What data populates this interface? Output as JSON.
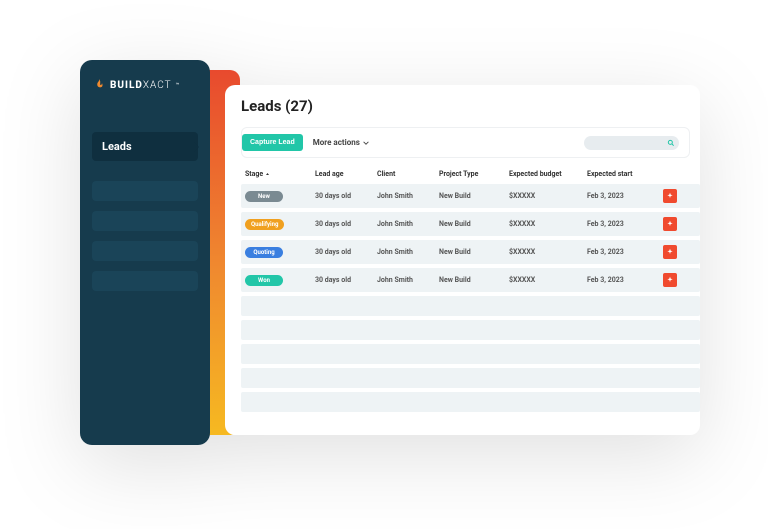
{
  "brand": {
    "bold": "BUILD",
    "thin": "XACT",
    "tm": "™"
  },
  "sidebar": {
    "active_item": "Leads"
  },
  "page": {
    "title_prefix": "Leads",
    "count": "27"
  },
  "toolbar": {
    "primary_label": "Capture Lead",
    "more_label": "More actions"
  },
  "columns": {
    "stage": "Stage",
    "lead_age": "Lead age",
    "client": "Client",
    "project_type": "Project Type",
    "expected_budget": "Expected budget",
    "expected_start": "Expected start"
  },
  "rows": [
    {
      "stage": "New",
      "stage_class": "new",
      "age": "30 days old",
      "client": "John Smith",
      "type": "New Build",
      "budget": "$XXXXX",
      "start": "Feb 3, 2023"
    },
    {
      "stage": "Qualifying",
      "stage_class": "qualifying",
      "age": "30 days old",
      "client": "John Smith",
      "type": "New Build",
      "budget": "$XXXXX",
      "start": "Feb 3, 2023"
    },
    {
      "stage": "Quoting",
      "stage_class": "quoting",
      "age": "30 days old",
      "client": "John Smith",
      "type": "New Build",
      "budget": "$XXXXX",
      "start": "Feb 3, 2023"
    },
    {
      "stage": "Won",
      "stage_class": "won",
      "age": "30 days old",
      "client": "John Smith",
      "type": "New Build",
      "budget": "$XXXXX",
      "start": "Feb 3, 2023"
    }
  ],
  "empty_rows": 5
}
